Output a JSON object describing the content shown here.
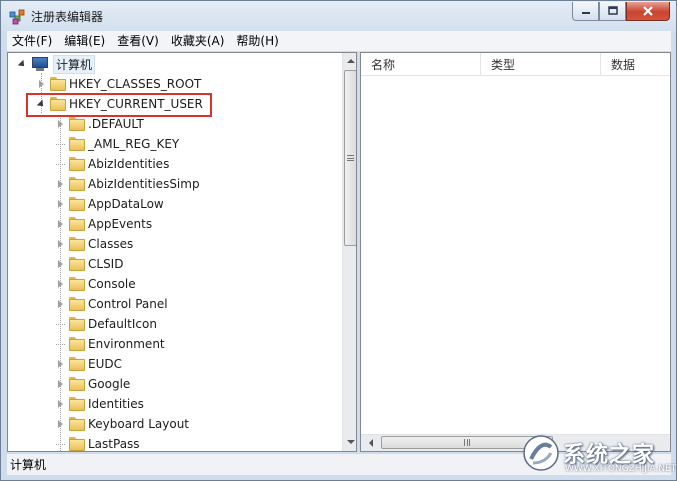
{
  "window": {
    "title": "注册表编辑器"
  },
  "menu": [
    {
      "label": "文件(F)"
    },
    {
      "label": "编辑(E)"
    },
    {
      "label": "查看(V)"
    },
    {
      "label": "收藏夹(A)"
    },
    {
      "label": "帮助(H)"
    }
  ],
  "tree": {
    "root": "计算机",
    "hives": [
      "HKEY_CLASSES_ROOT",
      "HKEY_CURRENT_USER"
    ],
    "children": [
      {
        "label": ".DEFAULT",
        "expandable": true
      },
      {
        "label": "_AML_REG_KEY",
        "expandable": false
      },
      {
        "label": "AbizIdentities",
        "expandable": false
      },
      {
        "label": "AbizIdentitiesSimp",
        "expandable": true
      },
      {
        "label": "AppDataLow",
        "expandable": true
      },
      {
        "label": "AppEvents",
        "expandable": true
      },
      {
        "label": "Classes",
        "expandable": true
      },
      {
        "label": "CLSID",
        "expandable": true
      },
      {
        "label": "Console",
        "expandable": true
      },
      {
        "label": "Control Panel",
        "expandable": true
      },
      {
        "label": "DefaultIcon",
        "expandable": false
      },
      {
        "label": "Environment",
        "expandable": false
      },
      {
        "label": "EUDC",
        "expandable": true
      },
      {
        "label": "Google",
        "expandable": true
      },
      {
        "label": "Identities",
        "expandable": true
      },
      {
        "label": "Keyboard Layout",
        "expandable": true
      },
      {
        "label": "LastPass",
        "expandable": false
      }
    ]
  },
  "list": {
    "columns": [
      "名称",
      "类型",
      "数据"
    ]
  },
  "statusbar": {
    "text": "计算机"
  },
  "watermark": {
    "text": "系统之家",
    "url": "WWW.XITONGZHIJIA.NET"
  },
  "colors": {
    "highlight": "#d9342b",
    "selection": "#e5f0fb",
    "folder": "#eac15a"
  }
}
